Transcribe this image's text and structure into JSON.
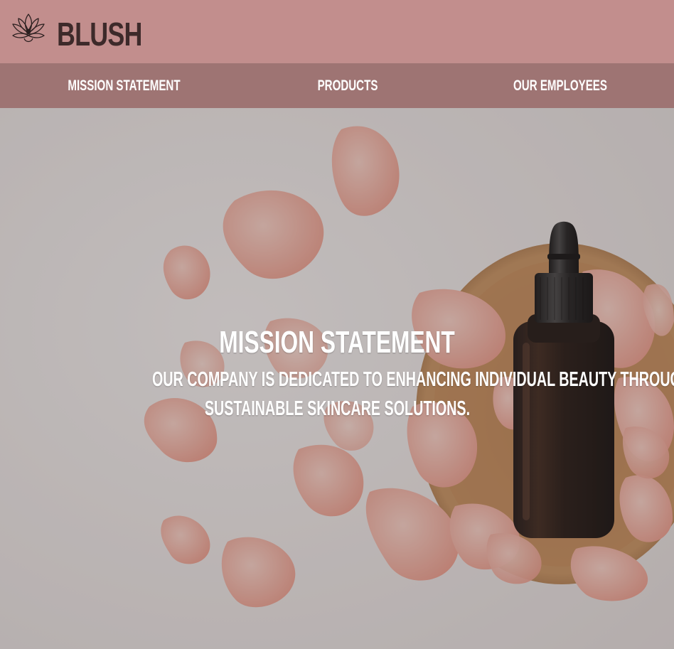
{
  "header": {
    "brand": "BLUSH",
    "logo_icon": "lotus-icon"
  },
  "nav": {
    "items": [
      {
        "label": "MISSION STATEMENT"
      },
      {
        "label": "PRODUCTS"
      },
      {
        "label": "OUR EMPLOYEES"
      }
    ]
  },
  "hero": {
    "title": "MISSION STATEMENT",
    "text_line1": "OUR COMPANY IS DEDICATED TO ENHANCING INDIVIDUAL BEAUTY THROUGH HIGH-QUALITY,",
    "text_line2": "SUSTAINABLE SKINCARE SOLUTIONS.",
    "image_subject": "rose-petals-and-dropper-bottle-photo"
  },
  "colors": {
    "header_bg": "#c28e8d",
    "nav_bg": "#9e7473",
    "brand_text": "#3d2a2a",
    "nav_text": "#ffffff"
  }
}
